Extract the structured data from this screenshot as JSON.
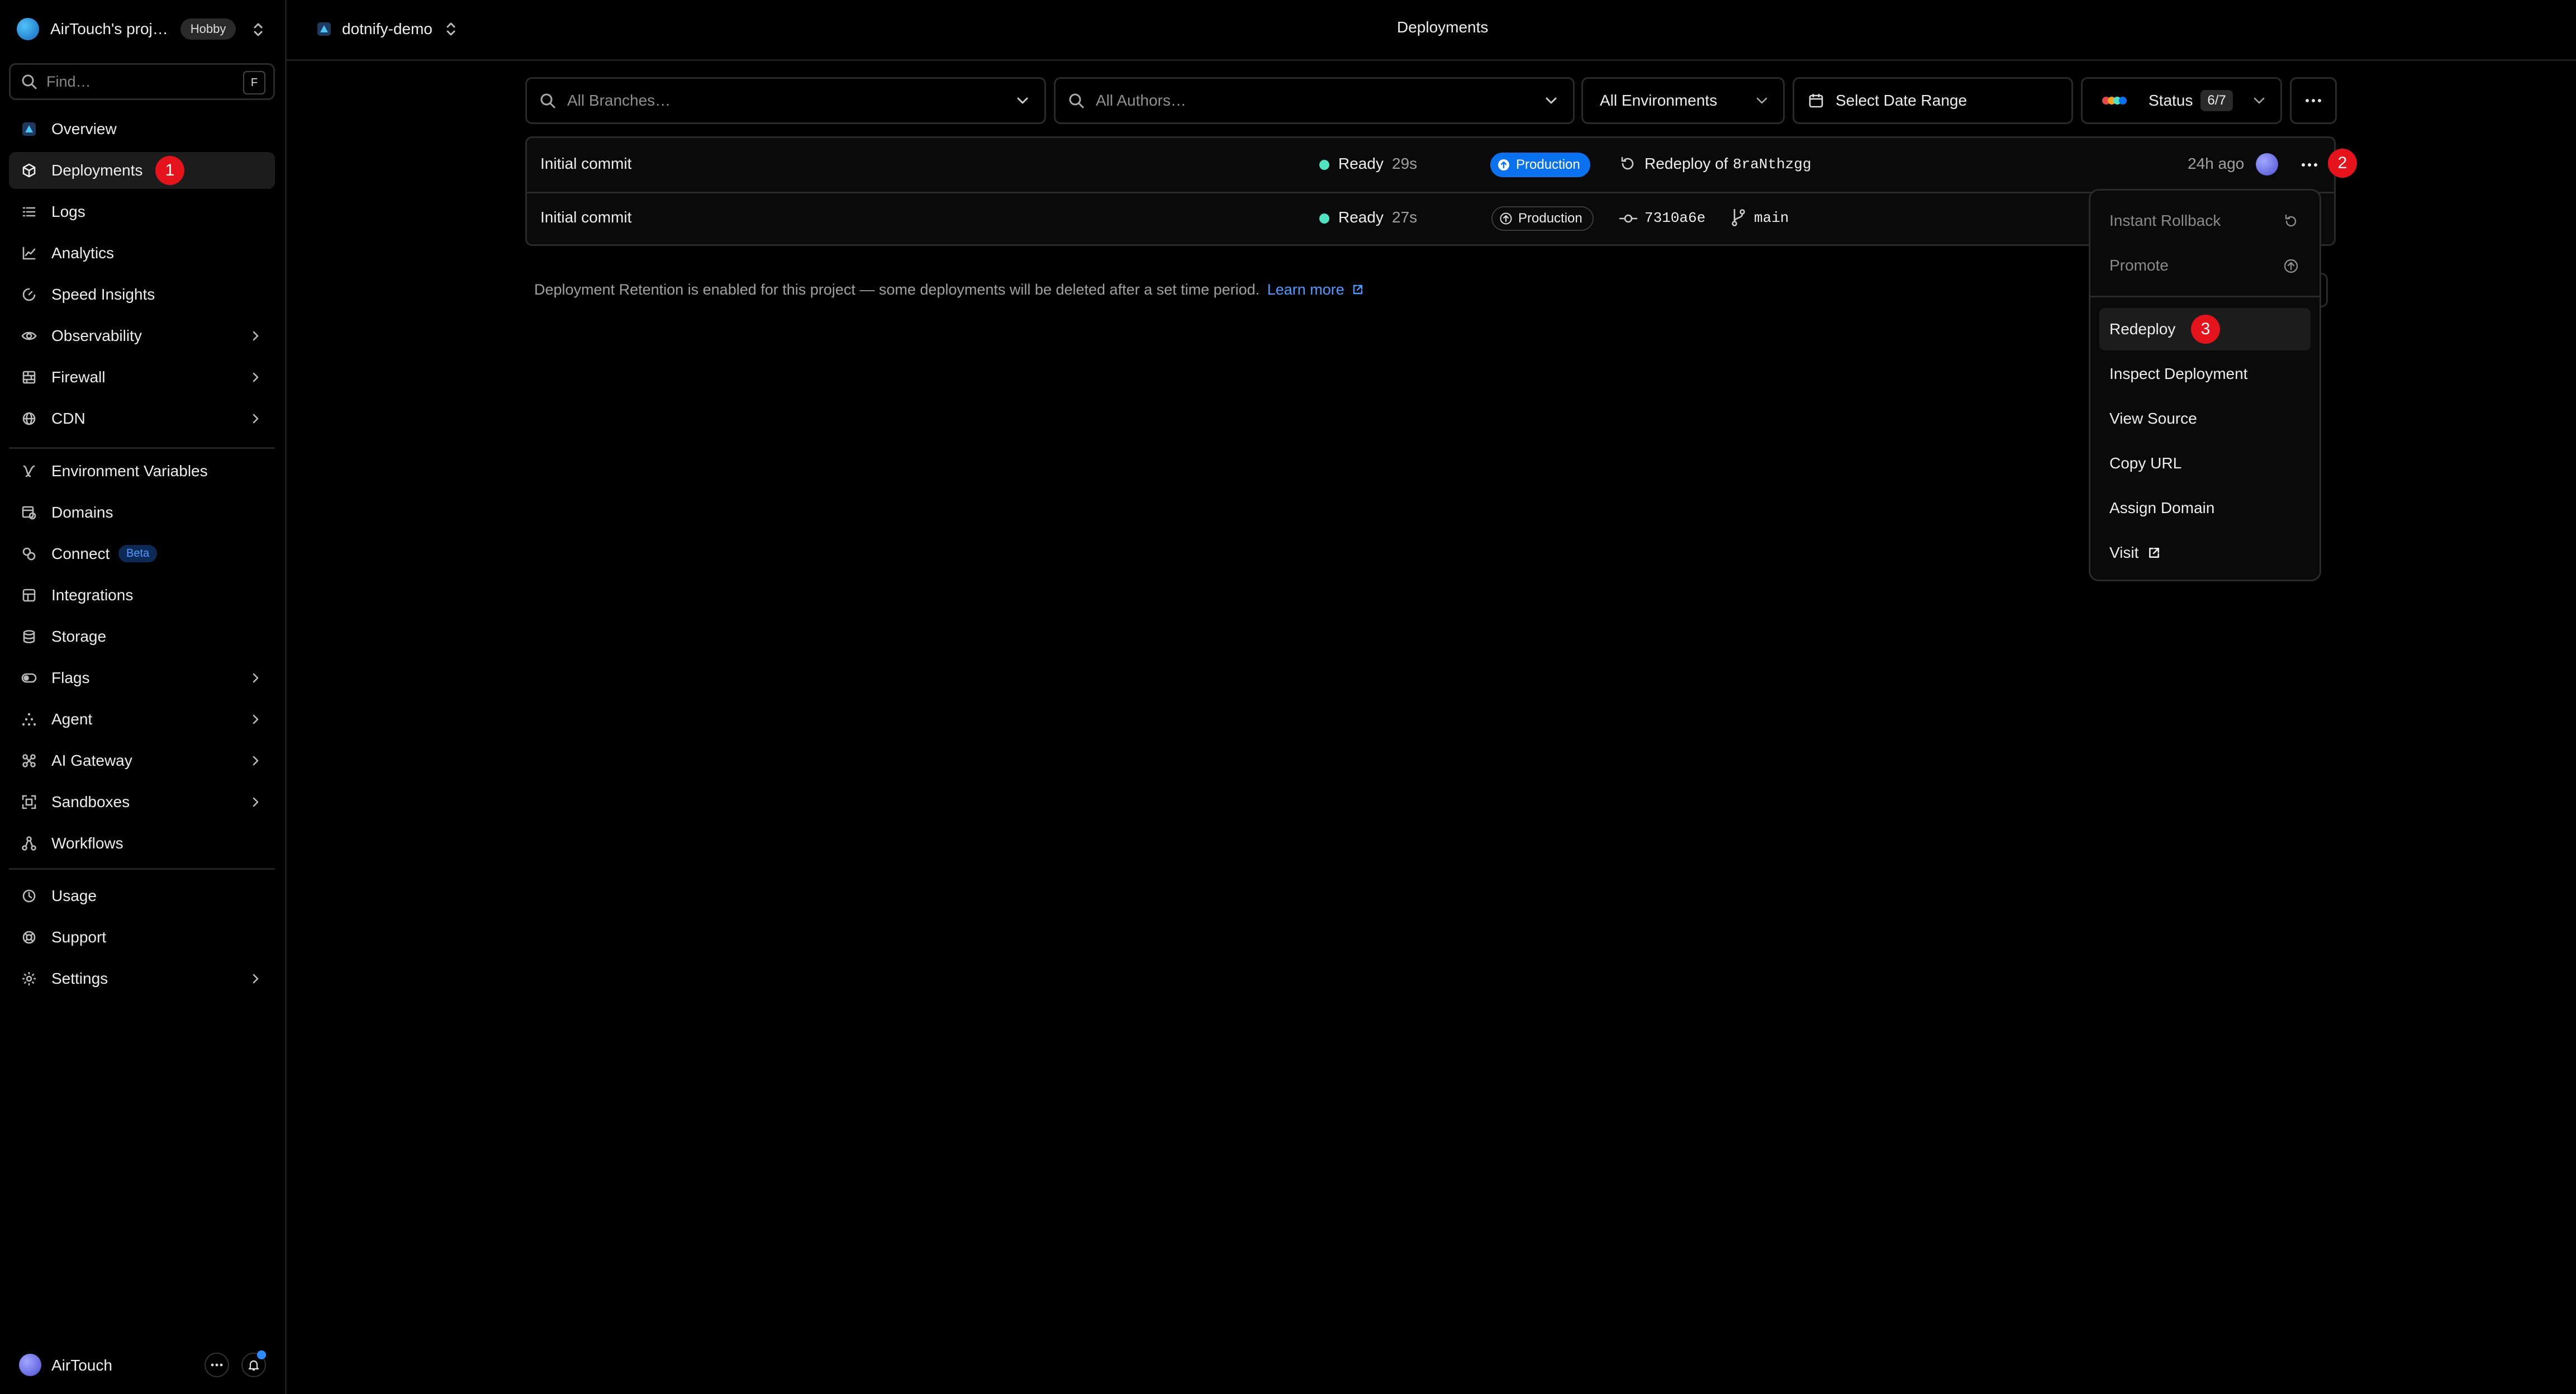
{
  "sidebar": {
    "team_name": "AirTouch's proj…",
    "plan_badge": "Hobby",
    "search_placeholder": "Find…",
    "search_shortcut": "F",
    "nav": [
      {
        "label": "Overview",
        "icon": "triangle-logo-icon"
      },
      {
        "label": "Deployments",
        "icon": "cube-icon",
        "active": true,
        "marker": "1"
      },
      {
        "label": "Logs",
        "icon": "list-icon"
      },
      {
        "label": "Analytics",
        "icon": "chart-line-icon"
      },
      {
        "label": "Speed Insights",
        "icon": "gauge-icon"
      },
      {
        "label": "Observability",
        "icon": "eye-icon",
        "has_children": true
      },
      {
        "label": "Firewall",
        "icon": "firewall-icon",
        "has_children": true
      },
      {
        "label": "CDN",
        "icon": "globe-icon",
        "has_children": true
      },
      {
        "label": "Environment Variables",
        "icon": "variable-icon"
      },
      {
        "label": "Domains",
        "icon": "domain-icon"
      },
      {
        "label": "Connect",
        "icon": "link-icon",
        "badge": "Beta"
      },
      {
        "label": "Integrations",
        "icon": "integrations-icon"
      },
      {
        "label": "Storage",
        "icon": "database-icon"
      },
      {
        "label": "Flags",
        "icon": "toggle-icon",
        "has_children": true
      },
      {
        "label": "Agent",
        "icon": "agent-icon",
        "has_children": true
      },
      {
        "label": "AI Gateway",
        "icon": "gateway-icon",
        "has_children": true
      },
      {
        "label": "Sandboxes",
        "icon": "sandbox-icon",
        "has_children": true
      },
      {
        "label": "Workflows",
        "icon": "workflow-icon"
      },
      {
        "label": "Usage",
        "icon": "clock-icon"
      },
      {
        "label": "Support",
        "icon": "support-icon"
      },
      {
        "label": "Settings",
        "icon": "gear-icon",
        "has_children": true
      }
    ],
    "user_name": "AirTouch"
  },
  "header": {
    "project_name": "dotnify-demo",
    "page_title": "Deployments"
  },
  "filters": {
    "branches_placeholder": "All Branches…",
    "authors_placeholder": "All Authors…",
    "environments": "All Environments",
    "date_range": "Select Date Range",
    "status_label": "Status",
    "status_count": "6/7"
  },
  "deployments": [
    {
      "message": "Initial commit",
      "status": "Ready",
      "duration": "29s",
      "environment": "Production",
      "source_prefix": "Redeploy of",
      "source_id": "8raNthzgg",
      "age": "24h ago",
      "marker": "2"
    },
    {
      "message": "Initial commit",
      "status": "Ready",
      "duration": "27s",
      "environment": "Production",
      "commit": "7310a6e",
      "branch": "main"
    }
  ],
  "retention_notice": "Deployment Retention is enabled for this project — some deployments will be deleted after a set time period.",
  "learn_more": "Learn more",
  "context_menu": {
    "items": [
      {
        "label": "Instant Rollback",
        "disabled": true,
        "icon": "rollback-icon"
      },
      {
        "label": "Promote",
        "disabled": true,
        "icon": "arrow-up-circle-icon"
      },
      {
        "label": "Redeploy",
        "highlighted": true,
        "marker": "3"
      },
      {
        "label": "Inspect Deployment"
      },
      {
        "label": "View Source"
      },
      {
        "label": "Copy URL"
      },
      {
        "label": "Assign Domain"
      },
      {
        "label": "Visit",
        "icon": "external-link-icon"
      }
    ]
  },
  "colors": {
    "ready": "#50e3c2",
    "production_blue": "#0a72ef",
    "marker_red": "#e5141c",
    "link_blue": "#4f9bff"
  }
}
